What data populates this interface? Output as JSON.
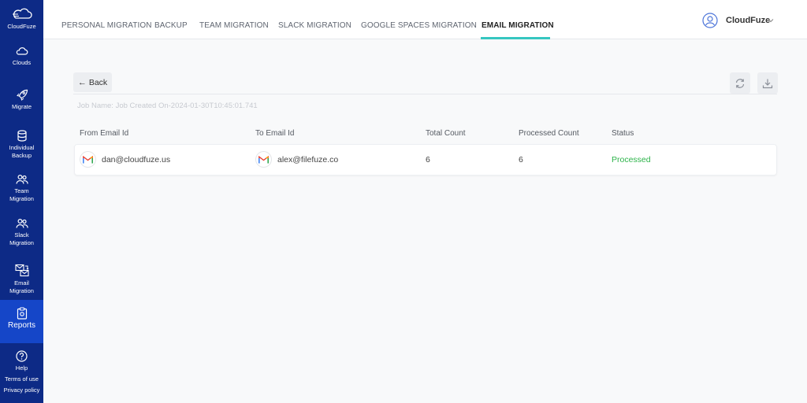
{
  "sidebar": {
    "brand": "CloudFuze",
    "items": [
      {
        "label": "Clouds",
        "icon": "cloud-icon"
      },
      {
        "label": "Migrate",
        "icon": "rocket-icon"
      },
      {
        "label_line1": "Individual",
        "label_line2": "Backup",
        "icon": "database-icon"
      },
      {
        "label_line1": "Team",
        "label_line2": "Migration",
        "icon": "users-icon"
      },
      {
        "label_line1": "Slack",
        "label_line2": "Migration",
        "icon": "users-icon"
      },
      {
        "label_line1": "Email",
        "label_line2": "Migration",
        "icon": "email-migration-icon"
      },
      {
        "label": "Reports",
        "icon": "clipboard-icon"
      }
    ],
    "help": "Help",
    "terms": "Terms of use",
    "privacy": "Privacy policy"
  },
  "header": {
    "tabs": [
      "PERSONAL MIGRATION",
      "BACKUP",
      "TEAM MIGRATION",
      "SLACK MIGRATION",
      "GOOGLE SPACES MIGRATION",
      "EMAIL MIGRATION"
    ],
    "active_tab": "EMAIL MIGRATION",
    "user_name": "CloudFuze"
  },
  "main": {
    "back_label": "Back",
    "job_name": "Job Name: Job Created On-2024-01-30T10:45:01.741",
    "columns": [
      "From Email Id",
      "To Email Id",
      "Total Count",
      "Processed Count",
      "Status"
    ],
    "rows": [
      {
        "from": "dan@cloudfuze.us",
        "to": "alex@filefuze.co",
        "total": "6",
        "processed": "6",
        "status": "Processed"
      }
    ]
  },
  "colors": {
    "sidebar_bg": "#0d2a86",
    "sidebar_active": "#1546c8",
    "tab_underline": "#35c6c0",
    "status_processed": "#2db34a"
  }
}
